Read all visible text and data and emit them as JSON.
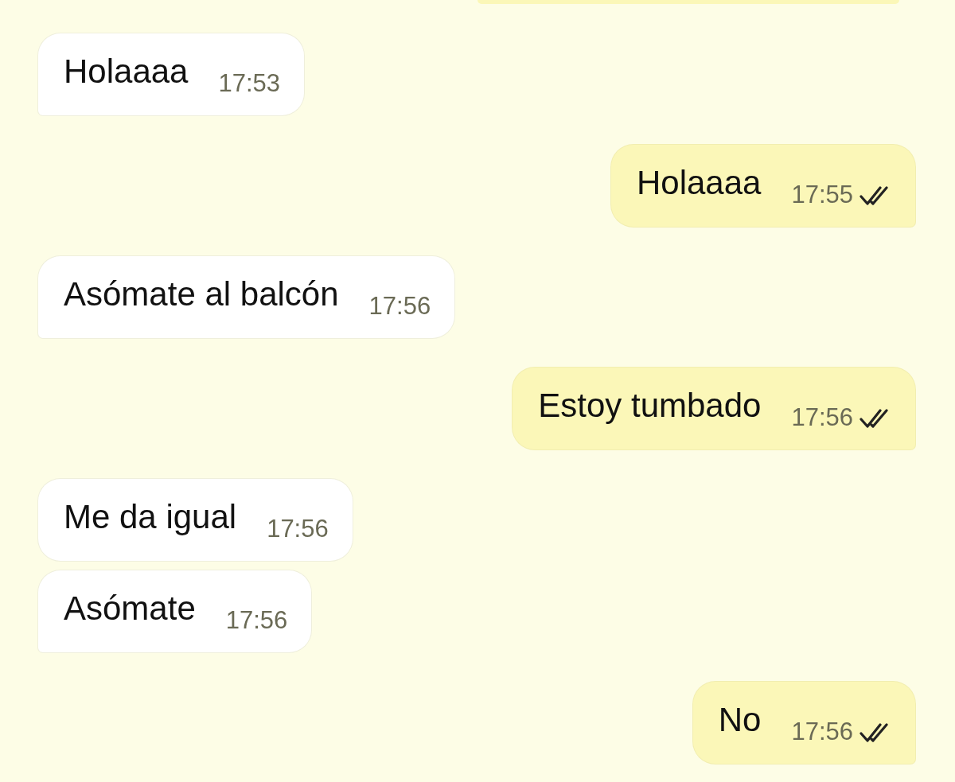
{
  "messages": [
    {
      "kind": "in",
      "text": "Holaaaa",
      "time": "17:53",
      "read": false
    },
    {
      "kind": "out",
      "text": "Holaaaa",
      "time": "17:55",
      "read": true
    },
    {
      "kind": "in",
      "text": "Asómate al balcón",
      "time": "17:56",
      "read": false
    },
    {
      "kind": "out",
      "text": "Estoy tumbado",
      "time": "17:56",
      "read": true
    },
    {
      "kind": "in",
      "text": "Me da igual",
      "time": "17:56",
      "read": false
    },
    {
      "kind": "in",
      "text": "Asómate",
      "time": "17:56",
      "read": false
    },
    {
      "kind": "out",
      "text": "No",
      "time": "17:56",
      "read": true
    }
  ]
}
